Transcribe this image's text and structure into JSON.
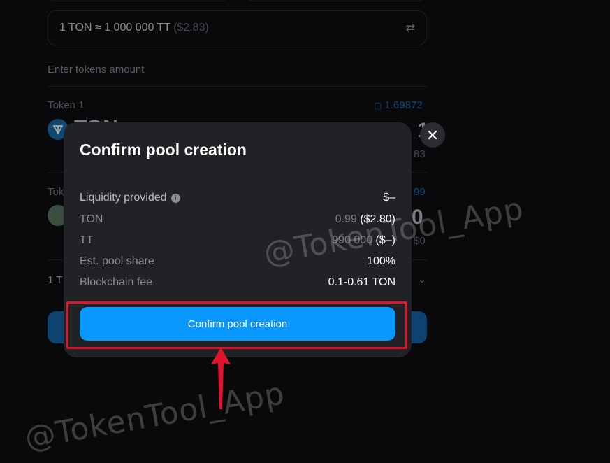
{
  "background": {
    "rate_text": "1 TON ≈ 1 000 000 TT",
    "rate_usd": "($2.83)",
    "section_title": "Enter tokens amount",
    "token1_label": "Token 1",
    "token1_balance": "1.69872",
    "token1_symbol_partial": "TON",
    "token1_amount_partial": "1",
    "token1_usd_partial": "83",
    "token2_label_partial": "Tok",
    "token2_balance_partial": "99",
    "token2_amount_partial": "0",
    "token2_usd_partial": "$0",
    "rate_row_partial": "1 T"
  },
  "modal": {
    "title": "Confirm pool creation",
    "rows": [
      {
        "label": "Liquidity provided",
        "value": "$–",
        "value_dim": ""
      },
      {
        "label": "TON",
        "value": "($2.80)",
        "value_dim": "0.99"
      },
      {
        "label": "TT",
        "value": "($–)",
        "value_dim": "990 000"
      },
      {
        "label": "Est. pool share",
        "value": "100%",
        "value_dim": ""
      },
      {
        "label": "Blockchain fee",
        "value": "0.1-0.61 TON",
        "value_dim": ""
      }
    ],
    "confirm_label": "Confirm pool creation"
  },
  "watermark": "@TokenTool_App",
  "colors": {
    "accent": "#0a98ff",
    "highlight": "#e0142c",
    "modal_bg": "#212226"
  }
}
